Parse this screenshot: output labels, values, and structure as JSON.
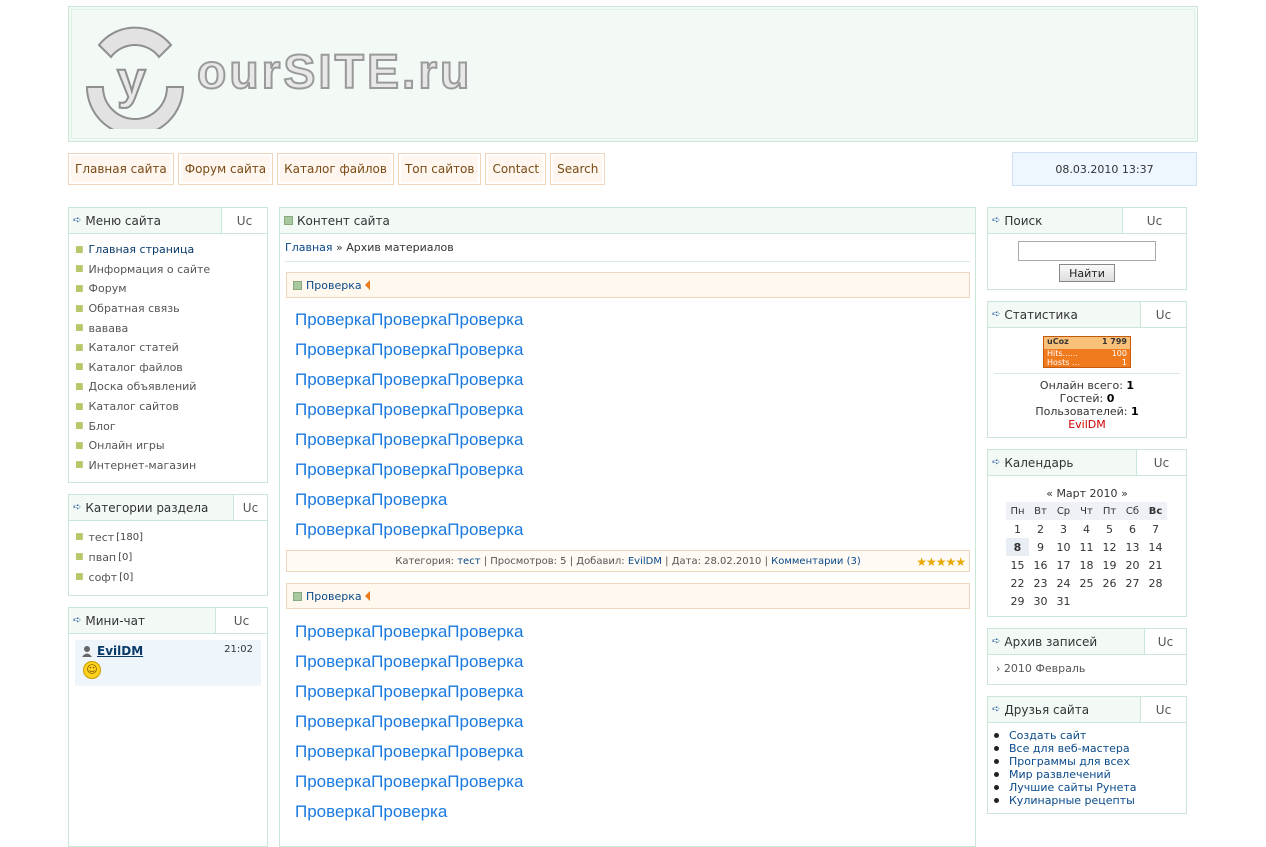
{
  "header": {
    "logo_text": "ourSITE.ru"
  },
  "topnav": {
    "items": [
      "Главная сайта",
      "Форум сайта",
      "Каталог файлов",
      "Топ сайтов",
      "Contact",
      "Search"
    ],
    "datetime": "08.03.2010 13:37"
  },
  "left": {
    "menu": {
      "title": "Меню сайта",
      "uc": "Uc",
      "items": [
        "Главная страница",
        "Информация о сайте",
        "Форум",
        "Обратная связь",
        "вавава",
        "Каталог статей",
        "Каталог файлов",
        "Доска объявлений",
        "Каталог сайтов",
        "Блог",
        "Онлайн игры",
        "Интернет-магазин"
      ]
    },
    "categories": {
      "title": "Категории раздела",
      "uc": "Uc",
      "items": [
        {
          "name": "тест",
          "count": "[180]"
        },
        {
          "name": "пвап",
          "count": "[0]"
        },
        {
          "name": "софт",
          "count": "[0]"
        }
      ]
    },
    "chat": {
      "title": "Мини-чат",
      "uc": "Uc",
      "user": "EvilDM",
      "time": "21:02",
      "message_icon": "smile-icon"
    }
  },
  "content": {
    "title": "Контент сайта",
    "breadcrumb": {
      "home": "Главная",
      "sep": "»",
      "current": "Архив материалов"
    },
    "entries": [
      {
        "title": "Проверка",
        "lines": [
          "ПроверкаПроверкаПроверка",
          "ПроверкаПроверкаПроверка",
          "ПроверкаПроверкаПроверка",
          "ПроверкаПроверкаПроверка",
          "ПроверкаПроверкаПроверка",
          "ПроверкаПроверкаПроверка",
          "ПроверкаПроверка",
          "ПроверкаПроверкаПроверка"
        ],
        "footer": {
          "category_label": "Категория:",
          "category": "тест",
          "views": "Просмотров: 5",
          "added_label": "Добавил:",
          "author": "EvilDM",
          "date": "Дата: 28.02.2010",
          "comments": "Комментарии (3)",
          "rating": 5
        }
      },
      {
        "title": "Проверка",
        "lines": [
          "ПроверкаПроверкаПроверка",
          "ПроверкаПроверкаПроверка",
          "ПроверкаПроверкаПроверка",
          "ПроверкаПроверкаПроверка",
          "ПроверкаПроверкаПроверка",
          "ПроверкаПроверкаПроверка",
          "ПроверкаПроверка"
        ]
      }
    ]
  },
  "right": {
    "search": {
      "title": "Поиск",
      "uc": "Uc",
      "button": "Найти",
      "value": ""
    },
    "stats": {
      "title": "Статистика",
      "uc": "Uc",
      "counter": {
        "brand": "uCoz",
        "total": "1 799",
        "hits_label": "Hits......",
        "hits": "100",
        "hosts_label": "Hosts ...",
        "hosts": "1"
      },
      "online_label": "Онлайн всего:",
      "online": "1",
      "guests_label": "Гостей:",
      "guests": "0",
      "users_label": "Пользователей:",
      "users": "1",
      "user": "EvilDM"
    },
    "calendar": {
      "title": "Календарь",
      "uc": "Uc",
      "prev": "«",
      "month": "Март 2010",
      "next": "»",
      "days": [
        "Пн",
        "Вт",
        "Ср",
        "Чт",
        "Пт",
        "Сб",
        "Вс"
      ],
      "weeks": [
        [
          "1",
          "2",
          "3",
          "4",
          "5",
          "6",
          "7"
        ],
        [
          "8",
          "9",
          "10",
          "11",
          "12",
          "13",
          "14"
        ],
        [
          "15",
          "16",
          "17",
          "18",
          "19",
          "20",
          "21"
        ],
        [
          "22",
          "23",
          "24",
          "25",
          "26",
          "27",
          "28"
        ],
        [
          "29",
          "30",
          "31",
          "",
          "",
          "",
          ""
        ]
      ],
      "today": "8"
    },
    "archive": {
      "title": "Архив записей",
      "uc": "Uc",
      "items": [
        "2010 Февраль"
      ]
    },
    "friends": {
      "title": "Друзья сайта",
      "uc": "Uc",
      "items": [
        "Создать сайт",
        "Все для веб-мастера",
        "Программы для всех",
        "Мир развлечений",
        "Лучшие сайты Рунета",
        "Кулинарные рецепты"
      ]
    }
  }
}
